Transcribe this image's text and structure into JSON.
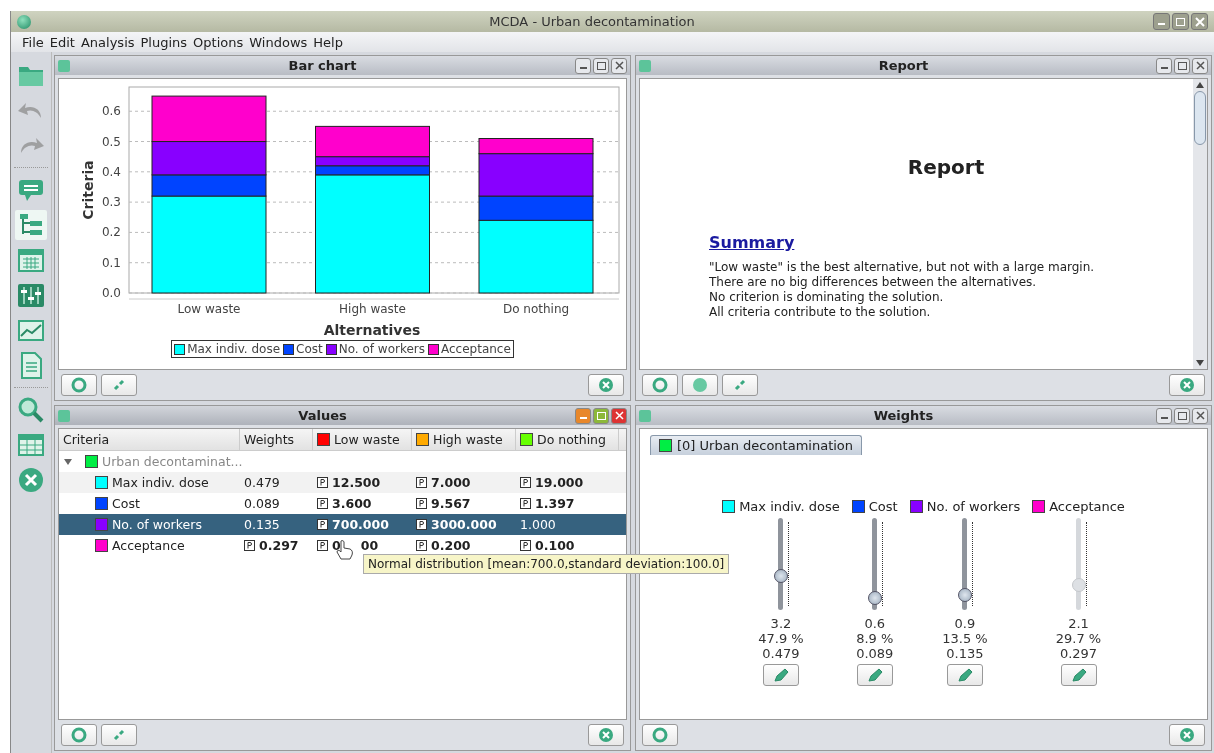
{
  "window": {
    "title": "MCDA - Urban decontamination"
  },
  "menu": [
    "File",
    "Edit",
    "Analysis",
    "Plugins",
    "Options",
    "Windows",
    "Help"
  ],
  "toolbar": [
    {
      "kind": "folder",
      "disabled": false,
      "selected": false
    },
    {
      "kind": "undo",
      "disabled": true,
      "selected": false
    },
    {
      "kind": "redo",
      "disabled": true,
      "selected": false
    },
    {
      "kind": "separator"
    },
    {
      "kind": "comment",
      "disabled": false,
      "selected": false
    },
    {
      "kind": "tree",
      "disabled": false,
      "selected": true
    },
    {
      "kind": "calendar",
      "disabled": false,
      "selected": false
    },
    {
      "kind": "sliders",
      "disabled": false,
      "selected": false
    },
    {
      "kind": "chart",
      "disabled": false,
      "selected": false
    },
    {
      "kind": "document",
      "disabled": false,
      "selected": false
    },
    {
      "kind": "separator"
    },
    {
      "kind": "search",
      "disabled": false,
      "selected": false
    },
    {
      "kind": "table",
      "disabled": false,
      "selected": false
    },
    {
      "kind": "close",
      "disabled": false,
      "selected": false
    }
  ],
  "bar_chart": {
    "title": "Bar chart",
    "active": false,
    "chart_data": {
      "type": "bar",
      "stacked": true,
      "grid": true,
      "xlabel": "Alternatives",
      "ylabel": "Criteria",
      "categories": [
        "Low waste",
        "High waste",
        "Do nothing"
      ],
      "series": [
        {
          "name": "Max indiv. dose",
          "color": "#00ffff",
          "values": [
            0.32,
            0.39,
            0.24
          ]
        },
        {
          "name": "Cost",
          "color": "#0044ff",
          "values": [
            0.07,
            0.03,
            0.08
          ]
        },
        {
          "name": "No. of workers",
          "color": "#8800ff",
          "values": [
            0.11,
            0.03,
            0.14
          ]
        },
        {
          "name": "Acceptance",
          "color": "#ff00cc",
          "values": [
            0.15,
            0.1,
            0.05
          ]
        }
      ],
      "ylim": [
        0,
        0.68
      ],
      "yticks": [
        {
          "value": 0,
          "label": "0.0"
        },
        {
          "value": 0.1,
          "label": "0.1"
        },
        {
          "value": 0.2,
          "label": "0.2"
        },
        {
          "value": 0.3,
          "label": "0.3"
        },
        {
          "value": 0.4,
          "label": "0.4"
        },
        {
          "value": 0.5,
          "label": "0.5"
        },
        {
          "value": 0.6,
          "label": "0.6"
        }
      ]
    }
  },
  "report": {
    "title": "Report",
    "active": false,
    "heading": "Report",
    "section": "Summary",
    "lines": [
      "\"Low waste\" is the best alternative, but not with a large margin.",
      "There are no big differences between the alternatives.",
      "No criterion is dominating the solution.",
      "All criteria contribute to the solution."
    ]
  },
  "values": {
    "title": "Values",
    "active": true,
    "columns": [
      {
        "label": "Criteria"
      },
      {
        "label": "Weights"
      },
      {
        "label": "Low waste",
        "color": "#ff0000"
      },
      {
        "label": "High waste",
        "color": "#ffaa00"
      },
      {
        "label": "Do nothing",
        "color": "#66ff00"
      }
    ],
    "root": {
      "label": "Urban decontaminat...",
      "color": "#00ee44",
      "expanded": true,
      "children": [
        {
          "label": "Max indiv. dose",
          "color": "#00ffff",
          "selected": false,
          "weight": {
            "text": "0.479",
            "probabilistic": false
          },
          "values": [
            {
              "text": "12.500",
              "probabilistic": true
            },
            {
              "text": "7.000",
              "probabilistic": true
            },
            {
              "text": "19.000",
              "probabilistic": true
            }
          ]
        },
        {
          "label": "Cost",
          "color": "#0044ff",
          "selected": false,
          "weight": {
            "text": "0.089",
            "probabilistic": false
          },
          "values": [
            {
              "text": "3.600",
              "probabilistic": true
            },
            {
              "text": "9.567",
              "probabilistic": true
            },
            {
              "text": "1.397",
              "probabilistic": true
            }
          ]
        },
        {
          "label": "No. of workers",
          "color": "#8800ff",
          "selected": true,
          "weight": {
            "text": "0.135",
            "probabilistic": false
          },
          "values": [
            {
              "text": "700.000",
              "probabilistic": true
            },
            {
              "text": "3000.000",
              "probabilistic": true
            },
            {
              "text": "1.000",
              "probabilistic": false
            }
          ]
        },
        {
          "label": "Acceptance",
          "color": "#ff00cc",
          "selected": false,
          "weight": {
            "text": "0.297",
            "probabilistic": true
          },
          "values": [
            {
              "text": "0",
              "tail": "00",
              "probabilistic": true
            },
            {
              "text": "0.200",
              "probabilistic": true
            },
            {
              "text": "0.100",
              "probabilistic": true
            }
          ]
        }
      ]
    },
    "tooltip": "Normal distribution [mean:700.0,standard deviation:100.0]"
  },
  "weights": {
    "title": "Weights",
    "active": false,
    "tab": {
      "label": "[0] Urban decontamination",
      "color": "#00ee44",
      "selected": true
    },
    "sliders": [
      {
        "name": "Max indiv. dose",
        "color": "#00ffff",
        "level": 0.32,
        "disabled": false,
        "value": "3.2",
        "percent": "47.9 %",
        "weight": "0.479"
      },
      {
        "name": "Cost",
        "color": "#0044ff",
        "level": 0.06,
        "disabled": false,
        "value": "0.6",
        "percent": "8.9 %",
        "weight": "0.089"
      },
      {
        "name": "No. of workers",
        "color": "#8800ff",
        "level": 0.09,
        "disabled": false,
        "value": "0.9",
        "percent": "13.5 %",
        "weight": "0.135"
      },
      {
        "name": "Acceptance",
        "color": "#ff00cc",
        "level": 0.21,
        "disabled": true,
        "value": "2.1",
        "percent": "29.7 %",
        "weight": "0.297"
      }
    ]
  }
}
